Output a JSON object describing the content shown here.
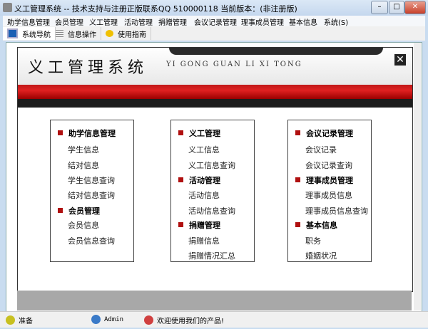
{
  "window": {
    "title": "义工管理系统 -- 技术支持与注册正版联系QQ 510000118    当前版本：(非注册版)",
    "minimize": "–",
    "maximize": "□",
    "close": "✕"
  },
  "menu": [
    "助学信息管理",
    "会员管理",
    "义工管理",
    "活动管理",
    "捐赠管理",
    "会议记录管理",
    "理事成员管理",
    "基本信息",
    "系统(S)"
  ],
  "toolbar": [
    {
      "label": "系统导航",
      "icon": "monitor-icon"
    },
    {
      "label": "信息操作",
      "icon": "grid-icon"
    },
    {
      "label": "使用指南",
      "icon": "help-icon"
    }
  ],
  "banner": {
    "title": "义工管理系统",
    "pinyin": "YI GONG GUAN LI XI TONG",
    "close": "✕"
  },
  "columns": [
    [
      {
        "h": "助学信息管理"
      },
      {
        "i": "学生信息"
      },
      {
        "i": "结对信息"
      },
      {
        "i": "学生信息查询"
      },
      {
        "i": "结对信息查询"
      },
      {
        "h": "会员管理"
      },
      {
        "i": "会员信息"
      },
      {
        "i": "会员信息查询"
      }
    ],
    [
      {
        "h": "义工管理"
      },
      {
        "i": "义工信息"
      },
      {
        "i": "义工信息查询"
      },
      {
        "h": "活动管理"
      },
      {
        "i": "活动信息"
      },
      {
        "i": "活动信息查询"
      },
      {
        "h": "捐赠管理"
      },
      {
        "i": "捐赠信息"
      },
      {
        "i": "捐赠情况汇总"
      }
    ],
    [
      {
        "h": "会议记录管理"
      },
      {
        "i": "会议记录"
      },
      {
        "i": "会议记录查询"
      },
      {
        "h": "理事成员管理"
      },
      {
        "i": "理事成员信息"
      },
      {
        "i": "理事成员信息查询"
      },
      {
        "h": "基本信息"
      },
      {
        "i": "职务"
      },
      {
        "i": "婚姻状况"
      }
    ]
  ],
  "status": {
    "state": "准备",
    "user": "Admin",
    "message": "欢迎使用我们的产品!"
  }
}
